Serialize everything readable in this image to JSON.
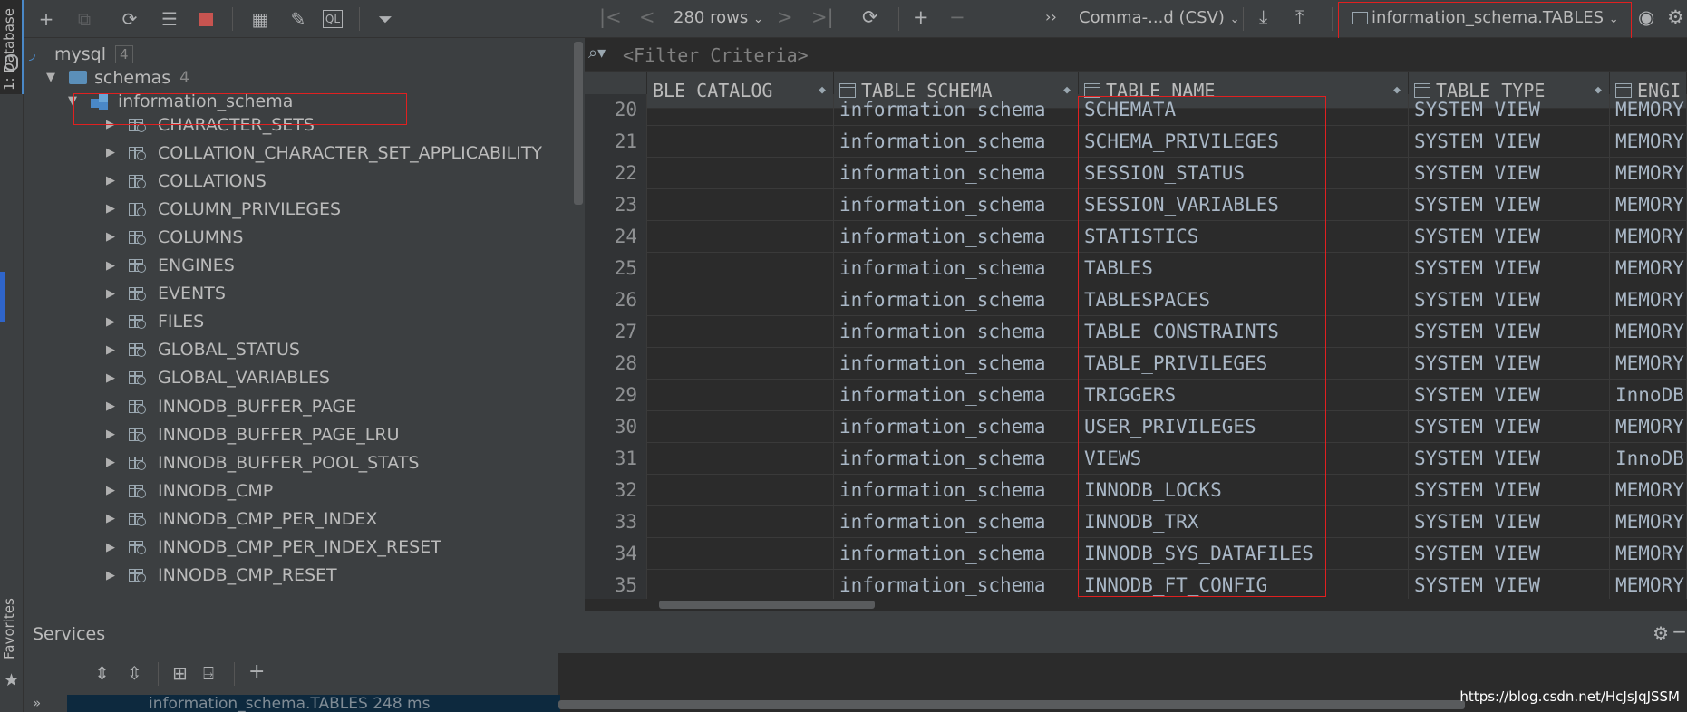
{
  "left_strip": {
    "database_tab": "1: Database",
    "favorites_tab": "Favorites"
  },
  "tree": {
    "root": {
      "label": "mysql",
      "count": "4"
    },
    "schemas": {
      "label": "schemas",
      "count": "4"
    },
    "schema": {
      "label": "information_schema"
    },
    "items": [
      "CHARACTER_SETS",
      "COLLATION_CHARACTER_SET_APPLICABILITY",
      "COLLATIONS",
      "COLUMN_PRIVILEGES",
      "COLUMNS",
      "ENGINES",
      "EVENTS",
      "FILES",
      "GLOBAL_STATUS",
      "GLOBAL_VARIABLES",
      "INNODB_BUFFER_PAGE",
      "INNODB_BUFFER_PAGE_LRU",
      "INNODB_BUFFER_POOL_STATS",
      "INNODB_CMP",
      "INNODB_CMP_PER_INDEX",
      "INNODB_CMP_PER_INDEX_RESET",
      "INNODB_CMP_RESET"
    ]
  },
  "grid_toolbar": {
    "rows_label": "280 rows",
    "export_format": "Comma-...d (CSV)",
    "table_selector": "information_schema.TABLES"
  },
  "filter": {
    "placeholder": "<Filter Criteria>"
  },
  "grid": {
    "columns": [
      "BLE_CATALOG",
      "TABLE_SCHEMA",
      "TABLE_NAME",
      "TABLE_TYPE",
      "ENGI"
    ],
    "rows": [
      {
        "n": "20",
        "catalog": "",
        "schema": "information_schema",
        "name": "SCHEMATA",
        "type": "SYSTEM VIEW",
        "engine": "MEMORY"
      },
      {
        "n": "21",
        "catalog": "",
        "schema": "information_schema",
        "name": "SCHEMA_PRIVILEGES",
        "type": "SYSTEM VIEW",
        "engine": "MEMORY"
      },
      {
        "n": "22",
        "catalog": "",
        "schema": "information_schema",
        "name": "SESSION_STATUS",
        "type": "SYSTEM VIEW",
        "engine": "MEMORY"
      },
      {
        "n": "23",
        "catalog": "",
        "schema": "information_schema",
        "name": "SESSION_VARIABLES",
        "type": "SYSTEM VIEW",
        "engine": "MEMORY"
      },
      {
        "n": "24",
        "catalog": "",
        "schema": "information_schema",
        "name": "STATISTICS",
        "type": "SYSTEM VIEW",
        "engine": "MEMORY"
      },
      {
        "n": "25",
        "catalog": "",
        "schema": "information_schema",
        "name": "TABLES",
        "type": "SYSTEM VIEW",
        "engine": "MEMORY"
      },
      {
        "n": "26",
        "catalog": "",
        "schema": "information_schema",
        "name": "TABLESPACES",
        "type": "SYSTEM VIEW",
        "engine": "MEMORY"
      },
      {
        "n": "27",
        "catalog": "",
        "schema": "information_schema",
        "name": "TABLE_CONSTRAINTS",
        "type": "SYSTEM VIEW",
        "engine": "MEMORY"
      },
      {
        "n": "28",
        "catalog": "",
        "schema": "information_schema",
        "name": "TABLE_PRIVILEGES",
        "type": "SYSTEM VIEW",
        "engine": "MEMORY"
      },
      {
        "n": "29",
        "catalog": "",
        "schema": "information_schema",
        "name": "TRIGGERS",
        "type": "SYSTEM VIEW",
        "engine": "InnoDB"
      },
      {
        "n": "30",
        "catalog": "",
        "schema": "information_schema",
        "name": "USER_PRIVILEGES",
        "type": "SYSTEM VIEW",
        "engine": "MEMORY"
      },
      {
        "n": "31",
        "catalog": "",
        "schema": "information_schema",
        "name": "VIEWS",
        "type": "SYSTEM VIEW",
        "engine": "InnoDB"
      },
      {
        "n": "32",
        "catalog": "",
        "schema": "information_schema",
        "name": "INNODB_LOCKS",
        "type": "SYSTEM VIEW",
        "engine": "MEMORY"
      },
      {
        "n": "33",
        "catalog": "",
        "schema": "information_schema",
        "name": "INNODB_TRX",
        "type": "SYSTEM VIEW",
        "engine": "MEMORY"
      },
      {
        "n": "34",
        "catalog": "",
        "schema": "information_schema",
        "name": "INNODB_SYS_DATAFILES",
        "type": "SYSTEM VIEW",
        "engine": "MEMORY"
      },
      {
        "n": "35",
        "catalog": "",
        "schema": "information_schema",
        "name": "INNODB_FT_CONFIG",
        "type": "SYSTEM VIEW",
        "engine": "MEMORY"
      }
    ]
  },
  "services": {
    "title": "Services",
    "row_label": "information_schema.TABLES 248 ms"
  },
  "watermark": "https://blog.csdn.net/HcJsJqJSSM",
  "colors": {
    "highlight": "#e02020",
    "panel": "#3c3f41",
    "editor": "#2b2b2b",
    "accent": "#4a88c7"
  }
}
